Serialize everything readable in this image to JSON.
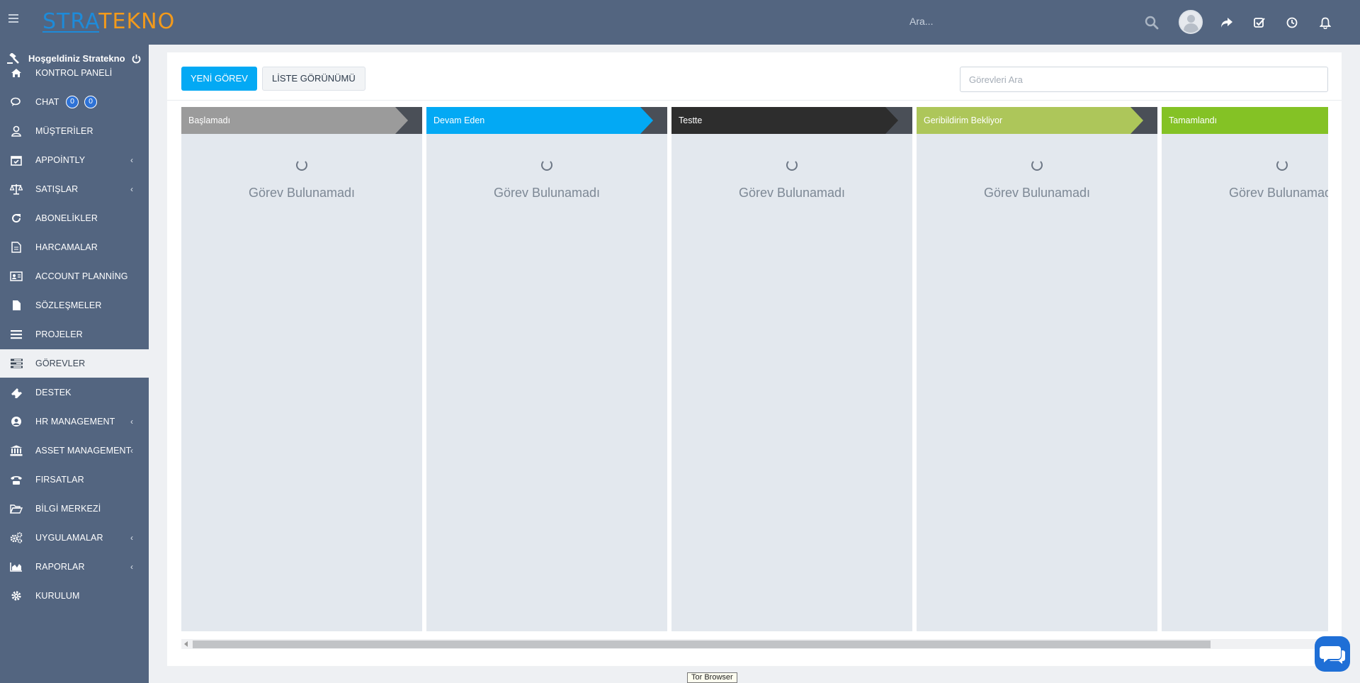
{
  "header": {
    "logo_part1": "STRA",
    "logo_part2": "TEKNO",
    "search_placeholder": "Ara...",
    "icons": [
      "search-icon",
      "avatar",
      "share-icon",
      "checkbox-icon",
      "clock-icon",
      "bell-icon"
    ]
  },
  "sidebar": {
    "welcome": "Hoşgeldiniz Stratekno",
    "items": [
      {
        "label": "KONTROL PANELİ",
        "icon": "home-icon",
        "has_submenu": false
      },
      {
        "label": "CHAT",
        "icon": "chat-icon",
        "has_submenu": false,
        "badges": [
          "0",
          "0"
        ]
      },
      {
        "label": "MÜŞTERİLER",
        "icon": "user-icon",
        "has_submenu": false
      },
      {
        "label": "APPOİNTLY",
        "icon": "calendar-check-icon",
        "has_submenu": true
      },
      {
        "label": "SATIŞLAR",
        "icon": "balance-scale-icon",
        "has_submenu": true
      },
      {
        "label": "ABONELİKLER",
        "icon": "refresh-icon",
        "has_submenu": false
      },
      {
        "label": "HARCAMALAR",
        "icon": "document-icon",
        "has_submenu": false
      },
      {
        "label": "ACCOUNT PLANNİNG",
        "icon": "id-card-icon",
        "has_submenu": false
      },
      {
        "label": "SÖZLEŞMELER",
        "icon": "file-icon",
        "has_submenu": false
      },
      {
        "label": "PROJELER",
        "icon": "bars-icon",
        "has_submenu": false
      },
      {
        "label": "GÖREVLER",
        "icon": "tasks-icon",
        "has_submenu": false,
        "active": true
      },
      {
        "label": "DESTEK",
        "icon": "ticket-icon",
        "has_submenu": false
      },
      {
        "label": "HR MANAGEMENT",
        "icon": "user-circle-icon",
        "has_submenu": true
      },
      {
        "label": "ASSET MANAGEMENT",
        "icon": "bank-icon",
        "has_submenu": true
      },
      {
        "label": "FIRSATLAR",
        "icon": "phone-icon",
        "has_submenu": false
      },
      {
        "label": "BİLGİ MERKEZİ",
        "icon": "folder-open-icon",
        "has_submenu": false
      },
      {
        "label": "UYGULAMALAR",
        "icon": "cogs-icon",
        "has_submenu": true
      },
      {
        "label": "RAPORLAR",
        "icon": "area-chart-icon",
        "has_submenu": true
      },
      {
        "label": "KURULUM",
        "icon": "gear-icon",
        "has_submenu": false
      }
    ]
  },
  "toolbar": {
    "new_task_label": "YENİ GÖREV",
    "list_view_label": "LİSTE GÖRÜNÜMÜ",
    "task_search_placeholder": "Görevleri Ara"
  },
  "kanban": {
    "columns": [
      {
        "title": "Başlamadı",
        "color": "#9b9b9b",
        "empty_text": "Görev Bulunamadı"
      },
      {
        "title": "Devam Eden",
        "color": "#03a9f4",
        "empty_text": "Görev Bulunamadı"
      },
      {
        "title": "Testte",
        "color": "#2d2d2d",
        "empty_text": "Görev Bulunamadı"
      },
      {
        "title": "Geribildirim Bekliyor",
        "color": "#adc65a",
        "empty_text": "Görev Bulunamadı"
      },
      {
        "title": "Tamamlandı",
        "color": "#84c225",
        "empty_text": "Görev Bulunamadı"
      }
    ]
  },
  "tooltip_text": "Tor Browser",
  "colors": {
    "sidebar_bg": "#536580",
    "accent": "#03a9f4",
    "page_bg": "#eef0f3"
  }
}
